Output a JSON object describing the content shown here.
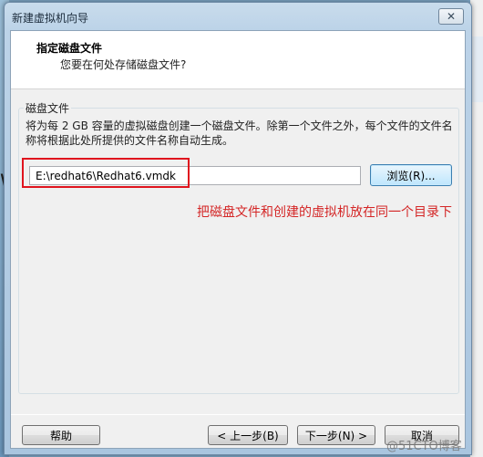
{
  "window": {
    "title": "新建虚拟机向导",
    "close_label": "✕"
  },
  "header": {
    "title": "指定磁盘文件",
    "subtitle": "您要在何处存储磁盘文件?"
  },
  "disk_file": {
    "group_label": "磁盘文件",
    "description": "将为每 2 GB 容量的虚拟磁盘创建一个磁盘文件。除第一个文件之外，每个文件的文件名称将根据此处所提供的文件名称自动生成。",
    "path_value": "E:\\redhat6\\Redhat6.vmdk",
    "browse_label": "浏览(R)..."
  },
  "annotation": {
    "text": "把磁盘文件和创建的虚拟机放在同一个目录下"
  },
  "footer": {
    "help_label": "帮助",
    "back_label": "< 上一步(B)",
    "next_label": "下一步(N) >",
    "cancel_label": "取消"
  },
  "watermark": {
    "text": "@51CTO博客"
  },
  "background": {
    "left_glyph": "W"
  },
  "colors": {
    "highlight": "#e0141e",
    "annotation": "#d42626",
    "title_bar": "#bcd3e8"
  }
}
